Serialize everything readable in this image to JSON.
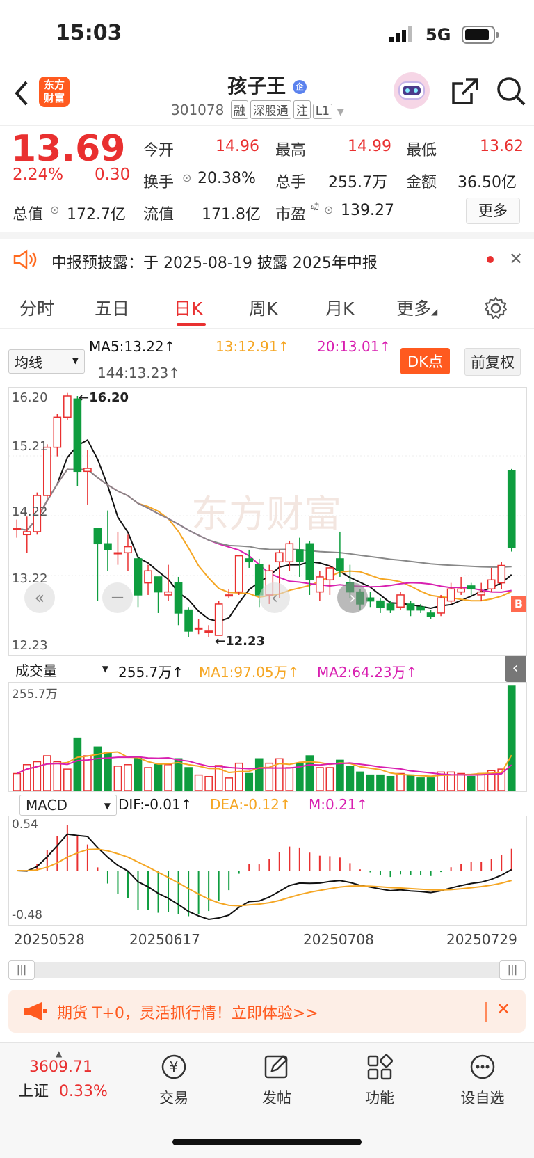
{
  "status_bar": {
    "time": "15:03",
    "network": "5G"
  },
  "nav": {
    "logo_line1": "东方",
    "logo_line2": "财富",
    "title": "孩子王",
    "title_badge": "企",
    "code": "301078",
    "tags": [
      "融",
      "深股通",
      "注",
      "L1"
    ]
  },
  "quote": {
    "price": "13.69",
    "change_pct": "2.24%",
    "change": "0.30",
    "fields": [
      {
        "label": "今开",
        "value": "14.96"
      },
      {
        "label": "最高",
        "value": "14.99"
      },
      {
        "label": "最低",
        "value": "13.62"
      },
      {
        "label": "换手",
        "value": "20.38%"
      },
      {
        "label": "总手",
        "value": "255.7万"
      },
      {
        "label": "金额",
        "value": "36.50亿"
      },
      {
        "label": "总值",
        "value": "172.7亿"
      },
      {
        "label": "流值",
        "value": "171.8亿"
      },
      {
        "label": "市盈",
        "value": "139.27"
      }
    ],
    "pe_sup": "动",
    "more_label": "更多"
  },
  "notice": {
    "text": "中报预披露：于 2025-08-19 披露 2025年中报"
  },
  "tabs": [
    "分时",
    "五日",
    "日K",
    "周K",
    "月K",
    "更多"
  ],
  "active_tab": "日K",
  "kline": {
    "indicator": "均线",
    "ma5": "MA5:13.22",
    "ma13": "13:12.91",
    "ma20": "20:13.01",
    "ma144": "144:13.23",
    "dk_label": "DK点",
    "adjust_label": "前复权",
    "y_labels": [
      "16.20",
      "15.21",
      "14.22",
      "13.22",
      "12.23"
    ],
    "high_mark": "16.20",
    "low_mark": "12.23",
    "watermark": "东方财富"
  },
  "volume": {
    "selector": "成交量",
    "value": "255.7万",
    "ma1": "MA1:97.05万",
    "ma2": "MA2:64.23万",
    "top_label": "255.7万"
  },
  "macd": {
    "selector": "MACD",
    "dif": "DIF:-0.01",
    "dea": "DEA:-0.12",
    "m": "M:0.21",
    "top": "0.54",
    "bottom": "-0.48"
  },
  "dates": [
    "20250528",
    "20250617",
    "20250708",
    "20250729"
  ],
  "banner": {
    "text": "期货 T+0，灵活抓行情！立即体验>>"
  },
  "bottom_bar": {
    "index_value": "3609.71",
    "index_name": "上证",
    "index_change": "0.33%",
    "items": [
      "交易",
      "发帖",
      "功能",
      "设自选"
    ]
  },
  "chart_data": {
    "type": "candlestick",
    "x_first": "20250528",
    "x_last": "20250730",
    "ylim": [
      12.23,
      16.2
    ],
    "candles": [
      [
        14.0,
        14.0,
        14.15,
        13.85
      ],
      [
        13.9,
        13.95,
        14.2,
        13.6
      ],
      [
        13.95,
        14.55,
        14.6,
        13.9
      ],
      [
        14.55,
        15.35,
        15.4,
        14.5
      ],
      [
        15.35,
        15.85,
        15.9,
        15.2
      ],
      [
        15.85,
        16.2,
        16.25,
        15.8
      ],
      [
        16.15,
        14.95,
        16.2,
        14.7
      ],
      [
        14.95,
        15.0,
        15.3,
        14.4
      ],
      [
        14.0,
        13.75,
        14.0,
        12.8
      ],
      [
        13.75,
        13.65,
        14.3,
        13.3
      ],
      [
        13.6,
        13.6,
        13.95,
        13.4
      ],
      [
        13.6,
        13.7,
        13.9,
        13.3
      ],
      [
        13.5,
        12.9,
        13.55,
        12.7
      ],
      [
        13.1,
        13.3,
        13.4,
        12.9
      ],
      [
        13.2,
        12.95,
        13.2,
        12.6
      ],
      [
        12.9,
        12.95,
        13.4,
        12.8
      ],
      [
        13.1,
        12.6,
        13.2,
        12.4
      ],
      [
        12.65,
        12.3,
        12.7,
        12.2
      ],
      [
        12.35,
        12.35,
        12.5,
        12.25
      ],
      [
        12.3,
        12.3,
        12.4,
        12.2
      ],
      [
        12.23,
        12.75,
        12.8,
        12.23
      ],
      [
        12.9,
        12.9,
        13.0,
        12.85
      ],
      [
        12.95,
        13.55,
        13.55,
        12.9
      ],
      [
        13.5,
        13.45,
        13.65,
        13.35
      ],
      [
        13.4,
        12.9,
        13.5,
        12.7
      ],
      [
        12.9,
        13.3,
        13.4,
        12.75
      ],
      [
        13.45,
        13.6,
        13.65,
        12.85
      ],
      [
        13.45,
        13.75,
        13.8,
        13.3
      ],
      [
        13.65,
        13.45,
        13.85,
        13.2
      ],
      [
        13.75,
        13.15,
        13.8,
        12.9
      ],
      [
        12.95,
        13.2,
        13.3,
        12.8
      ],
      [
        13.15,
        13.35,
        13.4,
        12.9
      ],
      [
        13.5,
        13.3,
        13.95,
        13.2
      ],
      [
        13.1,
        12.95,
        13.4,
        12.85
      ],
      [
        12.95,
        12.75,
        13.0,
        12.65
      ],
      [
        12.85,
        12.8,
        12.95,
        12.7
      ],
      [
        12.8,
        12.7,
        12.85,
        12.6
      ],
      [
        12.75,
        12.65,
        12.8,
        12.6
      ],
      [
        12.7,
        12.9,
        12.95,
        12.65
      ],
      [
        12.75,
        12.65,
        12.8,
        12.55
      ],
      [
        12.7,
        12.65,
        12.75,
        12.6
      ],
      [
        12.6,
        12.55,
        12.65,
        12.5
      ],
      [
        12.6,
        12.85,
        12.9,
        12.55
      ],
      [
        12.8,
        13.0,
        13.1,
        12.75
      ],
      [
        12.95,
        13.0,
        13.2,
        12.9
      ],
      [
        13.05,
        13.0,
        13.1,
        12.9
      ],
      [
        12.9,
        12.95,
        13.1,
        12.8
      ],
      [
        13.0,
        13.15,
        13.35,
        12.95
      ],
      [
        13.1,
        13.39,
        13.45,
        13.0
      ],
      [
        14.96,
        13.69,
        14.99,
        13.62
      ]
    ]
  }
}
